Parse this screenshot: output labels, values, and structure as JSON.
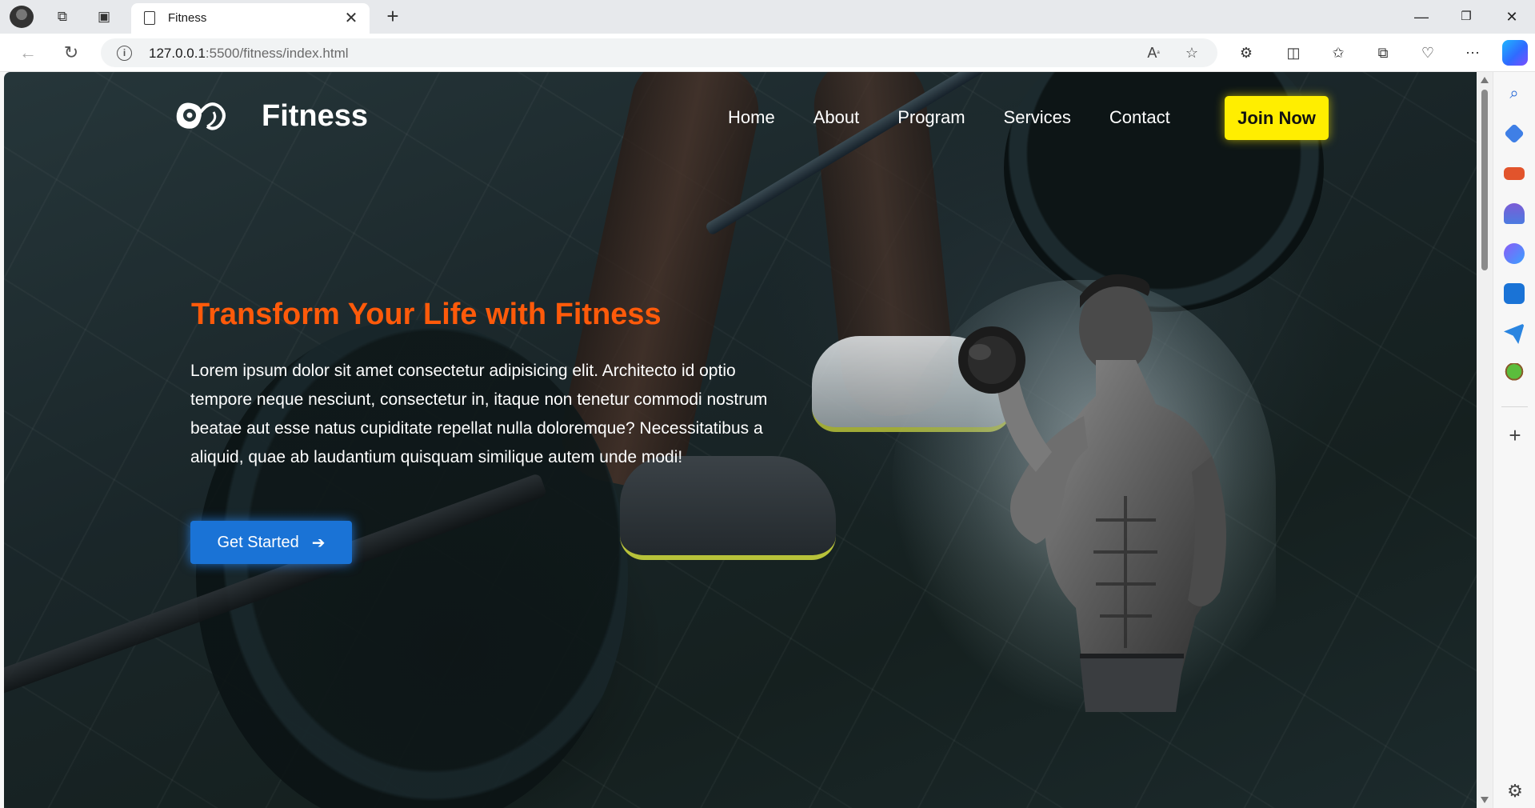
{
  "browser": {
    "tab_title": "Fitness",
    "url_host": "127.0.0.1",
    "url_rest": ":5500/fitness/index.html"
  },
  "site": {
    "brand": "Fitness",
    "nav": [
      "Home",
      "About",
      "Program",
      "Services",
      "Contact"
    ],
    "join_label": "Join Now"
  },
  "hero": {
    "title": "Transform Your Life with Fitness",
    "paragraph": "Lorem ipsum dolor sit amet consectetur adipisicing elit. Architecto id optio tempore neque nesciunt, consectetur in, itaque non tenetur commodi nostrum beatae aut esse natus cupiditate repellat nulla doloremque? Necessitatibus a aliquid, quae ab laudantium quisquam similique autem unde modi!",
    "cta_label": "Get Started",
    "cta_icon": "arrow-right-icon"
  },
  "colors": {
    "title_orange": "#ff5a0a",
    "join_yellow": "#ffee00",
    "cta_blue": "#1a73d6"
  }
}
